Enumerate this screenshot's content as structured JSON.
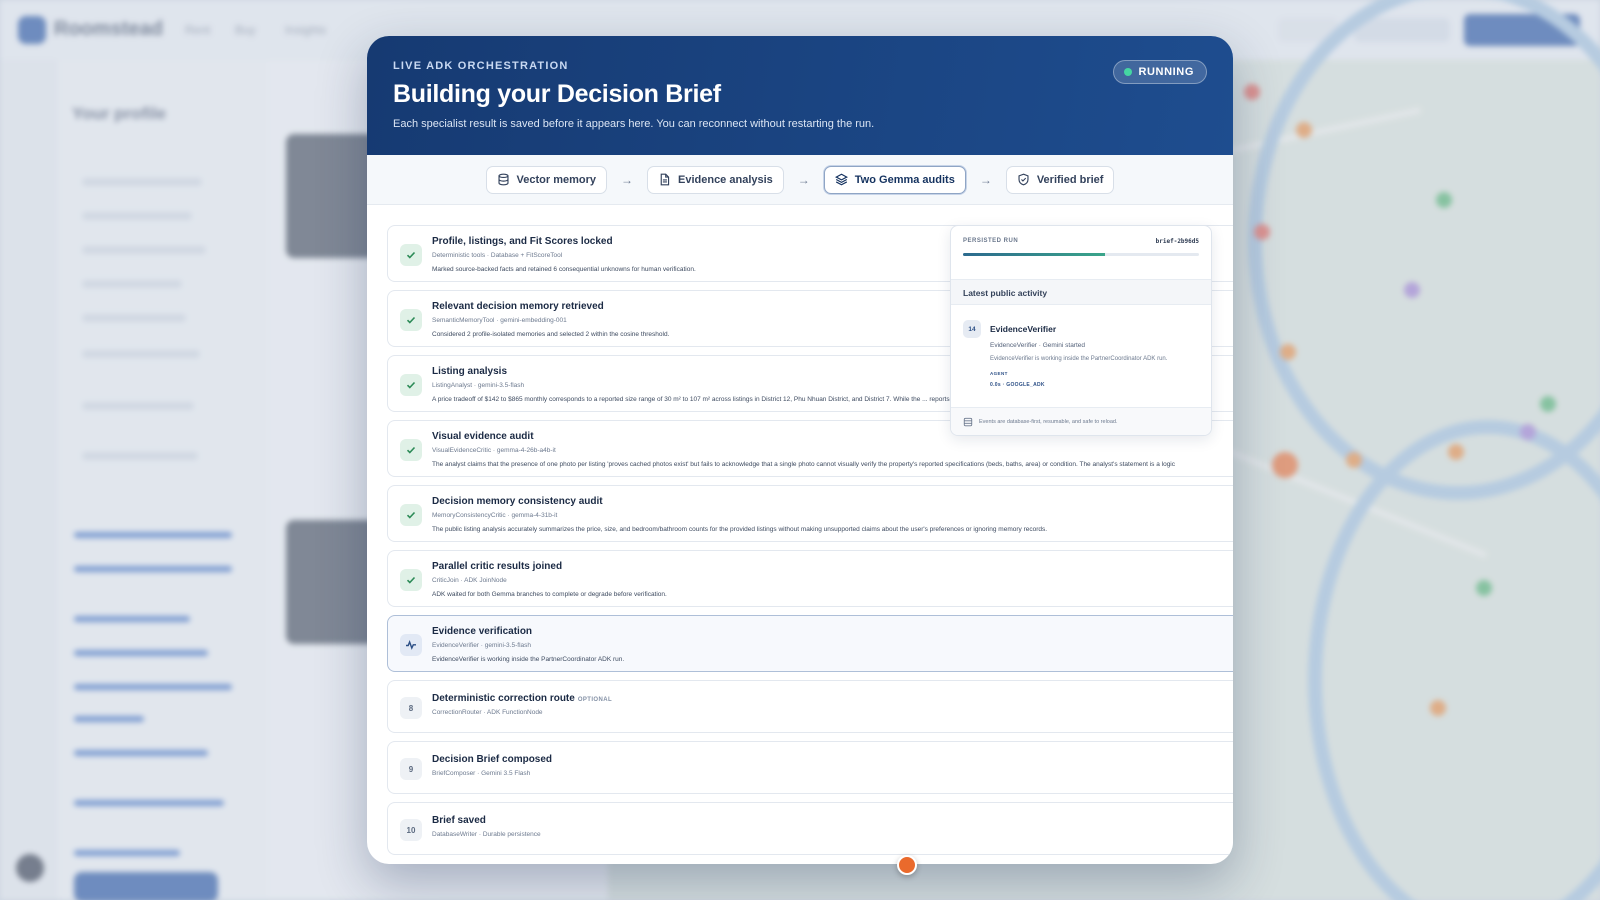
{
  "background": {
    "brand": "Roomstead",
    "nav": [
      "Rent",
      "Buy",
      "Insights"
    ],
    "sidebar_title": "Your profile"
  },
  "modal": {
    "eyebrow": "LIVE ADK ORCHESTRATION",
    "title": "Building your Decision Brief",
    "subtitle": "Each specialist result is saved before it appears here. You can reconnect without restarting the run.",
    "status": "RUNNING",
    "status_color": "#45d6a2"
  },
  "pipeline": [
    {
      "label": "Vector memory",
      "icon": "database-icon"
    },
    {
      "label": "Evidence analysis",
      "icon": "document-icon"
    },
    {
      "label": "Two Gemma audits",
      "icon": "layers-icon"
    },
    {
      "label": "Verified brief",
      "icon": "shield-check-icon"
    }
  ],
  "steps": [
    {
      "state": "done",
      "title": "Profile, listings, and Fit Scores locked",
      "meta": "Deterministic tools · Database + FitScoreTool",
      "desc": "Marked source-backed facts and retained 6 consequential unknowns for human verification."
    },
    {
      "state": "done",
      "title": "Relevant decision memory retrieved",
      "meta": "SemanticMemoryTool · gemini-embedding-001",
      "desc": "Considered 2 profile-isolated memories and selected 2 within the cosine threshold."
    },
    {
      "state": "done",
      "title": "Listing analysis",
      "meta": "ListingAnalyst · gemini-3.5-flash",
      "desc": "A price tradeoff of $142 to $865 monthly corresponds to a reported size range of 30 m² to 107 m² across listings in District 12, Phu Nhuan District, and District 7. While the ... reports"
    },
    {
      "state": "done",
      "title": "Visual evidence audit",
      "meta": "VisualEvidenceCritic · gemma-4-26b-a4b-it",
      "desc": "The analyst claims that the presence of one photo per listing 'proves cached photos exist' but fails to acknowledge that a single photo cannot visually verify the property's reported specifications (beds, baths, area) or condition. The analyst's statement is a logic"
    },
    {
      "state": "done",
      "title": "Decision memory consistency audit",
      "meta": "MemoryConsistencyCritic · gemma-4-31b-it",
      "desc": "The public listing analysis accurately summarizes the price, size, and bedroom/bathroom counts for the provided listings without making unsupported claims about the user's preferences or ignoring memory records."
    },
    {
      "state": "done",
      "title": "Parallel critic results joined",
      "meta": "CriticJoin · ADK JoinNode",
      "desc": "ADK waited for both Gemma branches to complete or degrade before verification."
    },
    {
      "state": "active",
      "title": "Evidence verification",
      "meta": "EvidenceVerifier · gemini-3.5-flash",
      "desc": "EvidenceVerifier is working inside the PartnerCoordinator ADK run."
    },
    {
      "state": "pending",
      "number": "8",
      "title": "Deterministic correction route",
      "optional": "OPTIONAL",
      "meta": "CorrectionRouter · ADK FunctionNode",
      "desc": ""
    },
    {
      "state": "pending",
      "number": "9",
      "title": "Decision Brief composed",
      "meta": "BriefComposer · Gemini 3.5 Flash",
      "desc": ""
    },
    {
      "state": "pending",
      "number": "10",
      "title": "Brief saved",
      "meta": "DatabaseWriter · Durable persistence",
      "desc": ""
    }
  ],
  "run_panel": {
    "label": "PERSISTED RUN",
    "run_id": "brief-2b96d5",
    "progress": 0.6,
    "activity_title": "Latest public activity",
    "activity": {
      "number": "14",
      "name": "EvidenceVerifier",
      "line1": "EvidenceVerifier · Gemini started",
      "line2": "EvidenceVerifier is working inside the PartnerCoordinator ADK run.",
      "tag1": "AGENT",
      "tag2": "0.0s · GOOGLE_ADK"
    },
    "footer": "Events are database-first, resumable, and safe to reload."
  }
}
